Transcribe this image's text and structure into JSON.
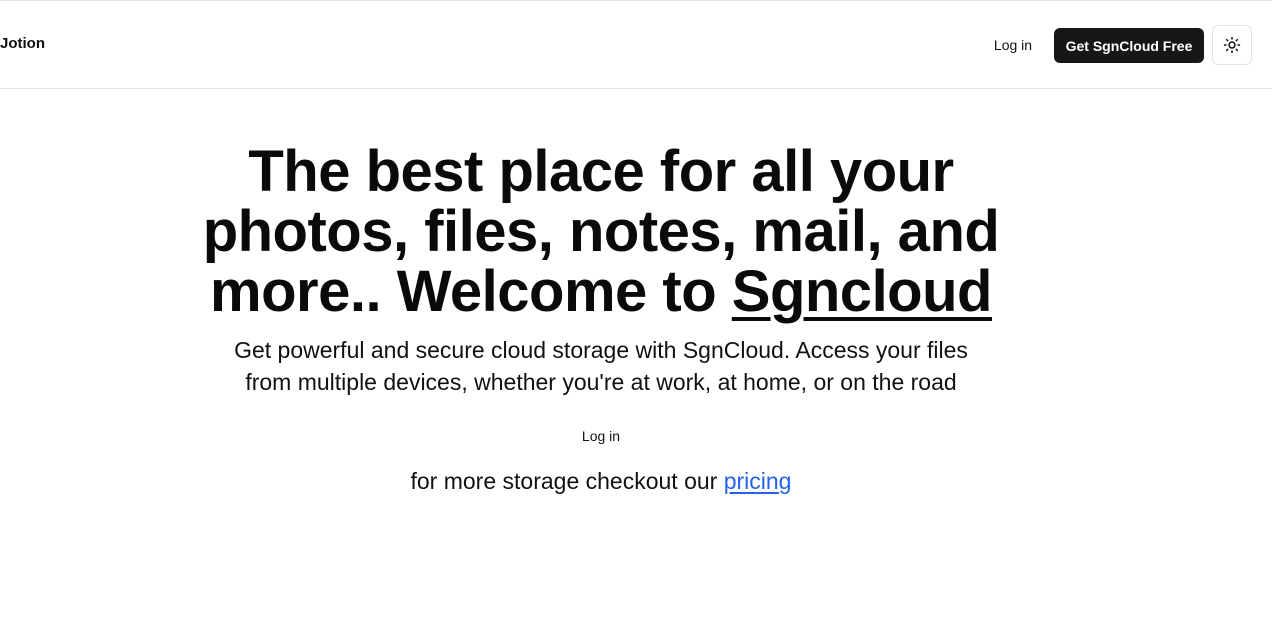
{
  "header": {
    "brand": "Jotion",
    "login_label": "Log in",
    "cta_label": "Get SgnCloud Free",
    "theme_icon": "sun-icon"
  },
  "hero": {
    "title_prefix": "The best place for all your photos, files, notes, mail, and more.. Welcome to",
    "title_brand": "Sgncloud",
    "subtitle": "Get powerful and secure cloud storage with SgnCloud. Access your files from multiple devices, whether you're at work, at home, or on the road",
    "login_label": "Log in",
    "pricing_text": "for more storage checkout our",
    "pricing_link": "pricing"
  },
  "colors": {
    "primary_button": "#171717",
    "link": "#2563eb",
    "border": "#e5e5e5"
  }
}
